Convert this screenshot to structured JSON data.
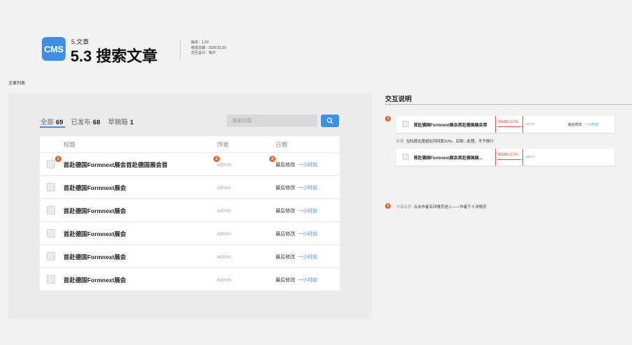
{
  "header": {
    "logo": "CMS",
    "breadcrumb": "5.文章",
    "title": "5.3 搜索文章",
    "meta": [
      "版本：1.20",
      "修改日期：2020.03.20",
      "交互设计：徐沪"
    ]
  },
  "section_label": "文章列表",
  "tabs": [
    {
      "label": "全部",
      "count": "69"
    },
    {
      "label": "已发布",
      "count": "68"
    },
    {
      "label": "草稿箱",
      "count": "1"
    }
  ],
  "search": {
    "placeholder": "搜索内容"
  },
  "table": {
    "headers": {
      "title": "标题",
      "author": "作者",
      "date": "日期"
    },
    "rows": [
      {
        "title": "首赴德国Formnext展会首赴德国展会首",
        "author": "admin",
        "date_label": "最后修改",
        "date_value": "一小时前"
      },
      {
        "title": "首赴德国Formnext展会",
        "author": "admin",
        "date_label": "最后修改",
        "date_value": "一小时前"
      },
      {
        "title": "首赴德国Formnext展会",
        "author": "admin",
        "date_label": "最后修改",
        "date_value": "一小时前"
      },
      {
        "title": "首赴德国Formnext展会",
        "author": "admin",
        "date_label": "最后修改",
        "date_value": "一小时前"
      },
      {
        "title": "首赴德国Formnext展会",
        "author": "admin",
        "date_label": "最后修改",
        "date_value": "一小时前"
      },
      {
        "title": "首赴德国Formnext展会",
        "author": "admin",
        "date_label": "最后修改",
        "date_value": "一小时前"
      }
    ]
  },
  "badges": [
    "1",
    "2",
    "3"
  ],
  "notes": {
    "title": "交互说明",
    "badge1": "1",
    "badge2": "2",
    "demo1": {
      "title": "首赴德国Formnext展会首赴德国展会首",
      "width_label": "Width:10%",
      "author": "admin",
      "date_label": "最后修改",
      "date_value": "一小时前"
    },
    "note1_key": "标题",
    "note1_text": "当标题长度超出列间距10%，后侧...处理，不予换行",
    "demo2": {
      "title": "首赴德国Formnext展会首赴德国展...",
      "width_label": "Width:10%",
      "author": "admin"
    },
    "note2_key": "作者名称",
    "note2_text": "点击作者名详情页进入——作者个人详情页"
  },
  "colors": {
    "accent": "#3d8fe6",
    "badge": "#e8632b",
    "warning_line": "#e74c3c"
  }
}
